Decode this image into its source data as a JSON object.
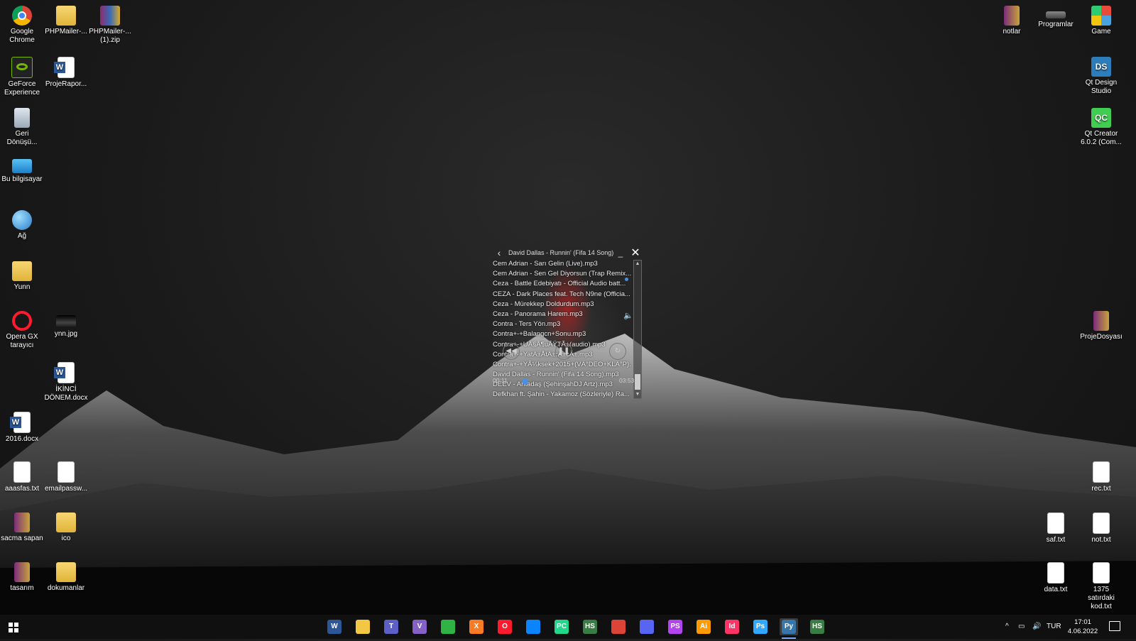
{
  "desktop": {
    "left_icons": [
      {
        "label": "Google Chrome",
        "icon": "chrome-icon"
      },
      {
        "label": "PHPMailer-...",
        "icon": "folder-icon"
      },
      {
        "label": "PHPMailer-... (1).zip",
        "icon": "zip-icon"
      },
      {
        "label": "GeForce Experience",
        "icon": "nvidia-icon"
      },
      {
        "label": "ProjeRapor...",
        "icon": "word-doc-icon"
      },
      {
        "label": "Geri Dönüşü...",
        "icon": "recycle-bin-icon"
      },
      {
        "label": "Bu bilgisayar",
        "icon": "computer-icon"
      },
      {
        "label": "Ağ",
        "icon": "network-icon"
      },
      {
        "label": "Yunn",
        "icon": "user-folder-icon"
      },
      {
        "label": "Opera GX tarayıcı",
        "icon": "opera-icon"
      },
      {
        "label": "ynn.jpg",
        "icon": "image-icon"
      },
      {
        "label": "İKİNCİ DÖNEM.docx",
        "icon": "word-doc-icon"
      },
      {
        "label": "2016.docx",
        "icon": "word-doc-icon"
      },
      {
        "label": "aaasfas.txt",
        "icon": "text-file-icon"
      },
      {
        "label": "emailpassw...",
        "icon": "text-file-icon"
      },
      {
        "label": "sacma sapan",
        "icon": "rar-icon"
      },
      {
        "label": "ico",
        "icon": "folder-icon"
      },
      {
        "label": "tasarım",
        "icon": "rar-icon"
      },
      {
        "label": "dokumanlar",
        "icon": "folder-icon"
      }
    ],
    "right_icons": [
      {
        "label": "notlar",
        "icon": "archive-icon"
      },
      {
        "label": "Programlar",
        "icon": "drive-icon"
      },
      {
        "label": "Game",
        "icon": "game-icon"
      },
      {
        "label": "Qt Design Studio",
        "icon": "qt-design-studio-icon"
      },
      {
        "label": "Qt Creator 6.0.2 (Com...",
        "icon": "qt-creator-icon"
      },
      {
        "label": "ProjeDosyası",
        "icon": "archive-icon"
      },
      {
        "label": "rec.txt",
        "icon": "text-file-icon"
      },
      {
        "label": "saf.txt",
        "icon": "text-file-icon"
      },
      {
        "label": "not.txt",
        "icon": "text-file-icon"
      },
      {
        "label": "data.txt",
        "icon": "text-file-icon"
      },
      {
        "label": "1375 satırdaki kod.txt",
        "icon": "text-file-icon"
      }
    ]
  },
  "player": {
    "title": "David Dallas - Runnin' (Fifa 14 Song)",
    "back_glyph": "‹",
    "minimize_glyph": "_",
    "close_glyph": "✕",
    "volume_glyph": "🔈",
    "current_time": "00:11",
    "total_time": "03:53",
    "progress": 0.05,
    "playlist": [
      "Cem Adrian - Sarı Gelin (Live).mp3",
      "Cem Adrian - Sen Gel Diyorsun (Trap Remix...",
      "Ceza - Battle Edebiyatı - Official Audio batt...",
      "CEZA - Dark Places feat. Tech N9ne (Officia...",
      "Ceza - Mürekkep Doldurdum.mp3",
      "Ceza - Panorama Harem.mp3",
      "Contra - Ters Yön.mp3",
      "Contra+-+Balangcn+Sonu.mp3",
      "Contra+-+UÃ§Ã¶uÃŸTÃ±(audio).mp3",
      "Contra+-+YatÄ±ÅtÄ±rÄ±cÄ±.mp3",
      "Contra+-+YÃ¼ksek+2015+(VÄ°DEO+KLÄ°P)...",
      "David Dallas - Runnin' (Fifa 14 Song).mp3",
      "DEEV - Arkadaş (ŞehinşahDJ Artz).mp3",
      "Defkhan ft. Şahin - Yakamoz (Sözleriyle) Ra..."
    ]
  },
  "taskbar": {
    "apps": [
      {
        "name": "word",
        "text": "W",
        "color": "#2b5797",
        "active": false
      },
      {
        "name": "file-explorer",
        "text": "",
        "color": "#f2c744",
        "active": false
      },
      {
        "name": "teams",
        "text": "T",
        "color": "#5b5fc7",
        "active": false
      },
      {
        "name": "visual-studio",
        "text": "V",
        "color": "#8661c5",
        "active": false
      },
      {
        "name": "chat",
        "text": "",
        "color": "#2fb344",
        "active": false
      },
      {
        "name": "xampp",
        "text": "X",
        "color": "#fb7a24",
        "active": false
      },
      {
        "name": "opera-gx",
        "text": "O",
        "color": "#ff1b2d",
        "active": false
      },
      {
        "name": "messenger",
        "text": "",
        "color": "#0a84ff",
        "active": false
      },
      {
        "name": "pycharm",
        "text": "PC",
        "color": "#21d789",
        "active": false
      },
      {
        "name": "hs-app",
        "text": "HS",
        "color": "#3a7d44",
        "active": false
      },
      {
        "name": "chrome",
        "text": "",
        "color": "#db4437",
        "active": false
      },
      {
        "name": "discord",
        "text": "",
        "color": "#5865f2",
        "active": false
      },
      {
        "name": "phpstorm",
        "text": "PS",
        "color": "#b345f1",
        "active": false
      },
      {
        "name": "illustrator",
        "text": "Ai",
        "color": "#ff9a00",
        "active": false
      },
      {
        "name": "indesign",
        "text": "Id",
        "color": "#ff3366",
        "active": false
      },
      {
        "name": "photoshop",
        "text": "Ps",
        "color": "#31a8ff",
        "active": false
      },
      {
        "name": "python",
        "text": "Py",
        "color": "#3776ab",
        "active": true
      },
      {
        "name": "hs-app-2",
        "text": "HS",
        "color": "#3a7d44",
        "active": false
      }
    ],
    "tray": {
      "chevron": "^",
      "language": "TUR",
      "time": "17:01",
      "date": "4.06.2022"
    }
  }
}
